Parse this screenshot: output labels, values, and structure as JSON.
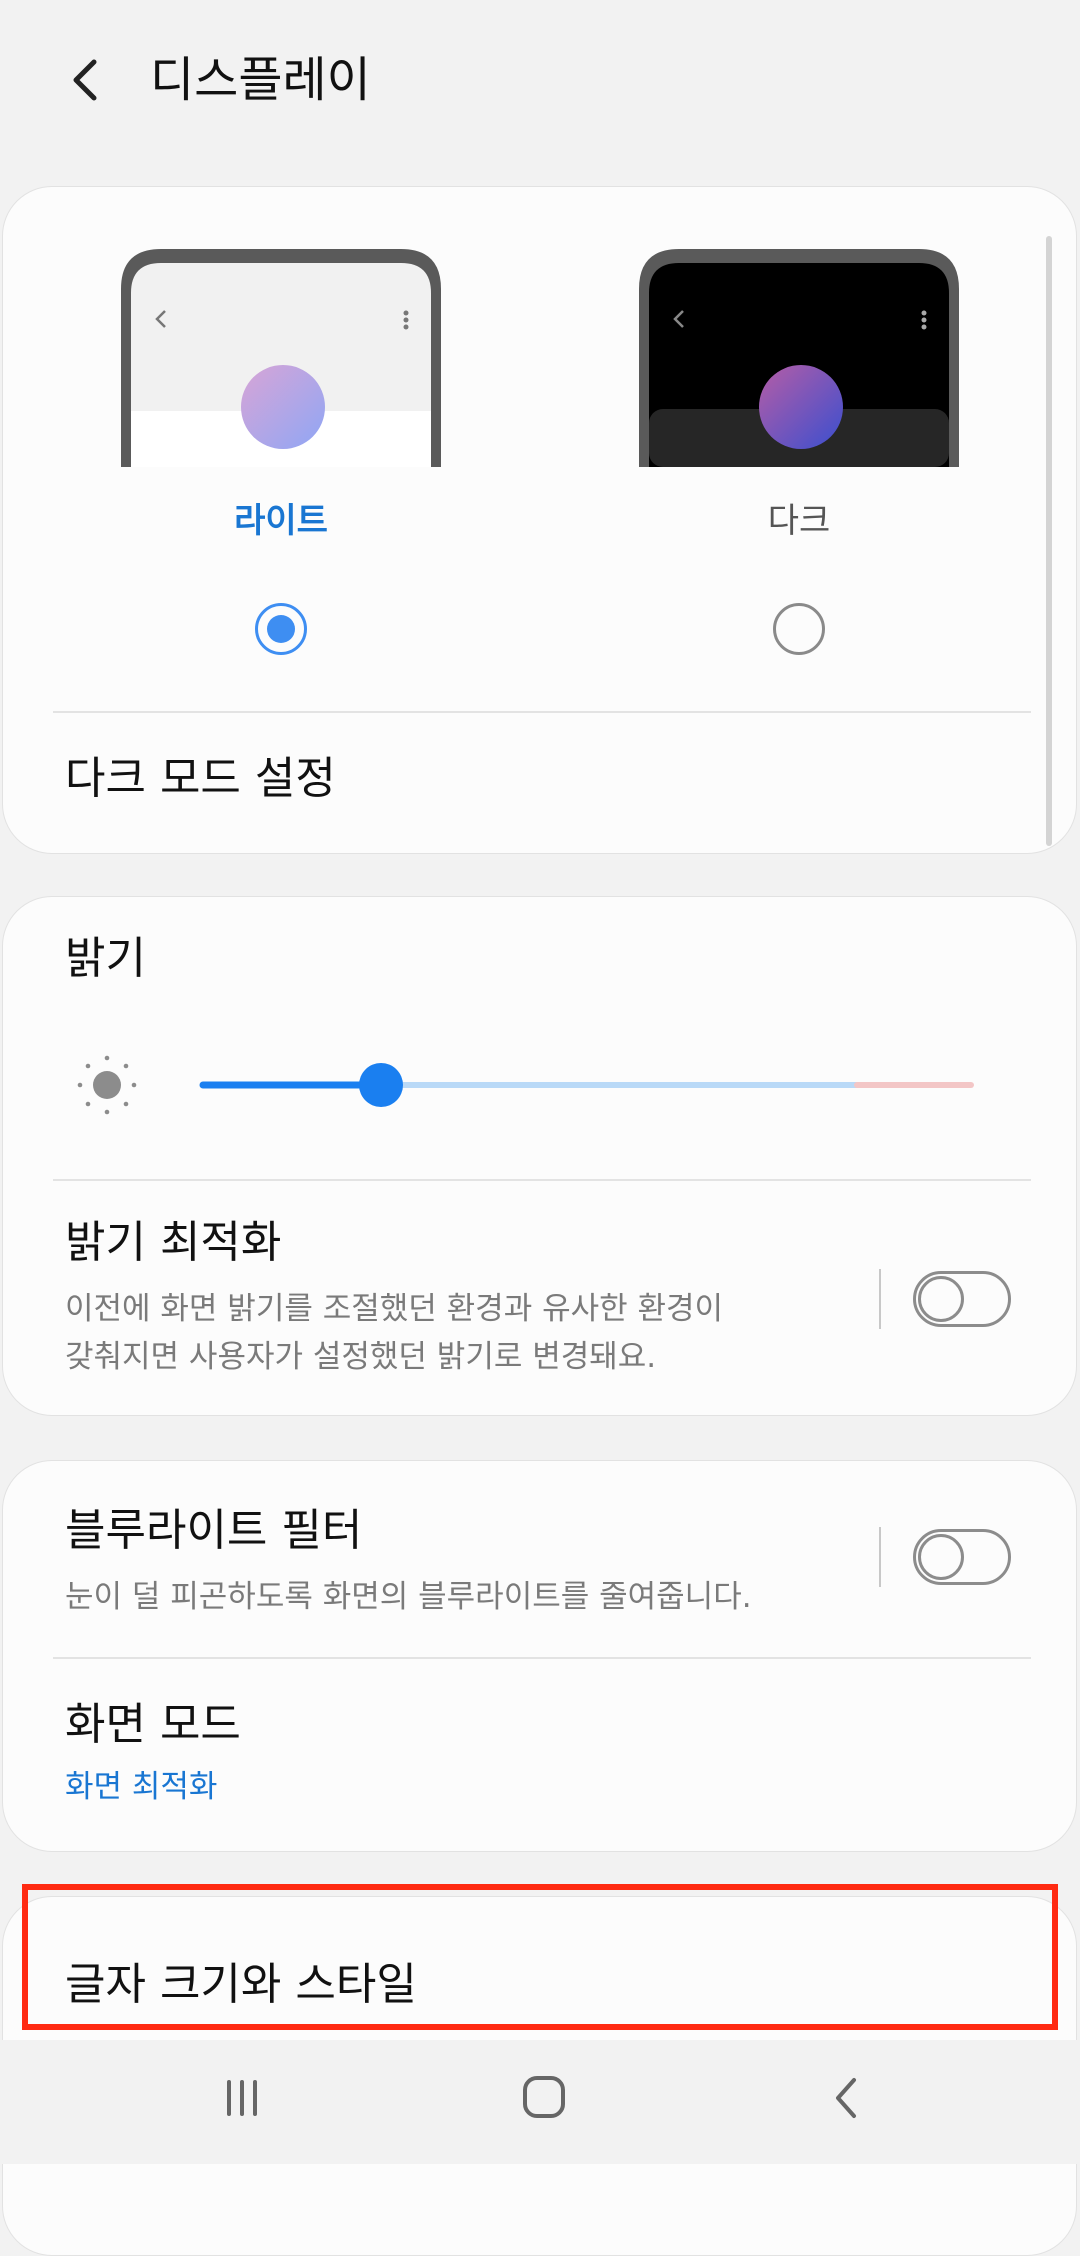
{
  "header": {
    "title": "디스플레이"
  },
  "theme": {
    "light_label": "라이트",
    "dark_label": "다크",
    "selected": "light",
    "dark_mode_settings_label": "다크 모드 설정"
  },
  "brightness": {
    "title": "밝기",
    "level_percent": 23
  },
  "adaptive_brightness": {
    "title": "밝기 최적화",
    "description_line1": "이전에 화면 밝기를 조절했던 환경과 유사한 환경이",
    "description_line2": "갖춰지면 사용자가 설정했던 밝기로 변경돼요.",
    "enabled": false
  },
  "blue_light": {
    "title": "블루라이트 필터",
    "description": "눈이 덜 피곤하도록 화면의 블루라이트를 줄여줍니다.",
    "enabled": false
  },
  "screen_mode": {
    "title": "화면 모드",
    "value": "화면 최적화"
  },
  "font": {
    "title": "글자 크기와 스타일"
  },
  "colors": {
    "accent": "#1976d2",
    "slider_active": "#1a7ff0",
    "slider_track": "#b9d9f7",
    "slider_warn": "#f3c6c6",
    "highlight": "#ff2a12"
  }
}
